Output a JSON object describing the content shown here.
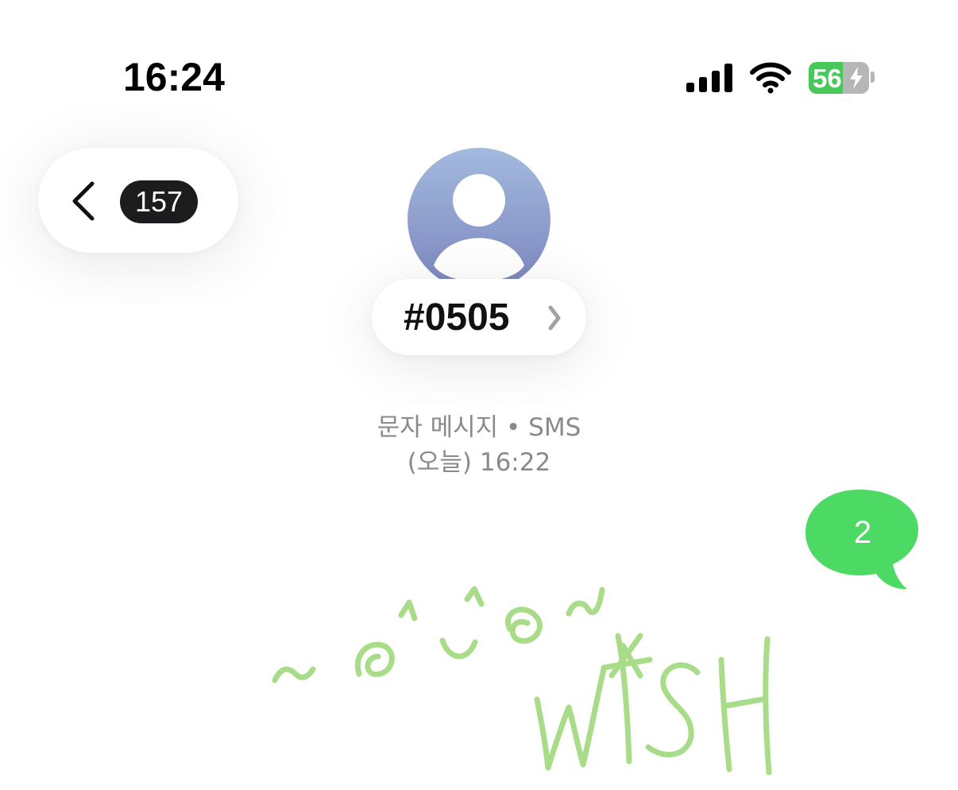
{
  "status_bar": {
    "time": "16:24",
    "battery_level": "56",
    "battery_percent": 56,
    "signal_icon": "cellular-signal-icon",
    "wifi_icon": "wifi-icon",
    "charging_icon": "bolt-icon"
  },
  "header": {
    "back_icon": "chevron-left-icon",
    "unread_count": "157",
    "contact_name": "#0505",
    "avatar_icon": "person-silhouette-icon",
    "details_icon": "chevron-right-icon"
  },
  "conversation": {
    "service_label": "문자 메시지 • SMS",
    "timestamp": "(오늘) 16:22",
    "messages": [
      {
        "direction": "outgoing",
        "text": "2"
      }
    ]
  },
  "annotation": {
    "kind": "handwritten-drawing",
    "text": "~ ◎^◡^◎ ~ WISH"
  },
  "colors": {
    "message_bubble": "#4cd964",
    "battery_fill": "#48c75a",
    "badge": "#1c1c1e",
    "secondary_text": "#8a8a8e",
    "avatar_top": "#a3b9de",
    "avatar_bottom": "#7c86be",
    "doodle": "#a8dc88"
  }
}
